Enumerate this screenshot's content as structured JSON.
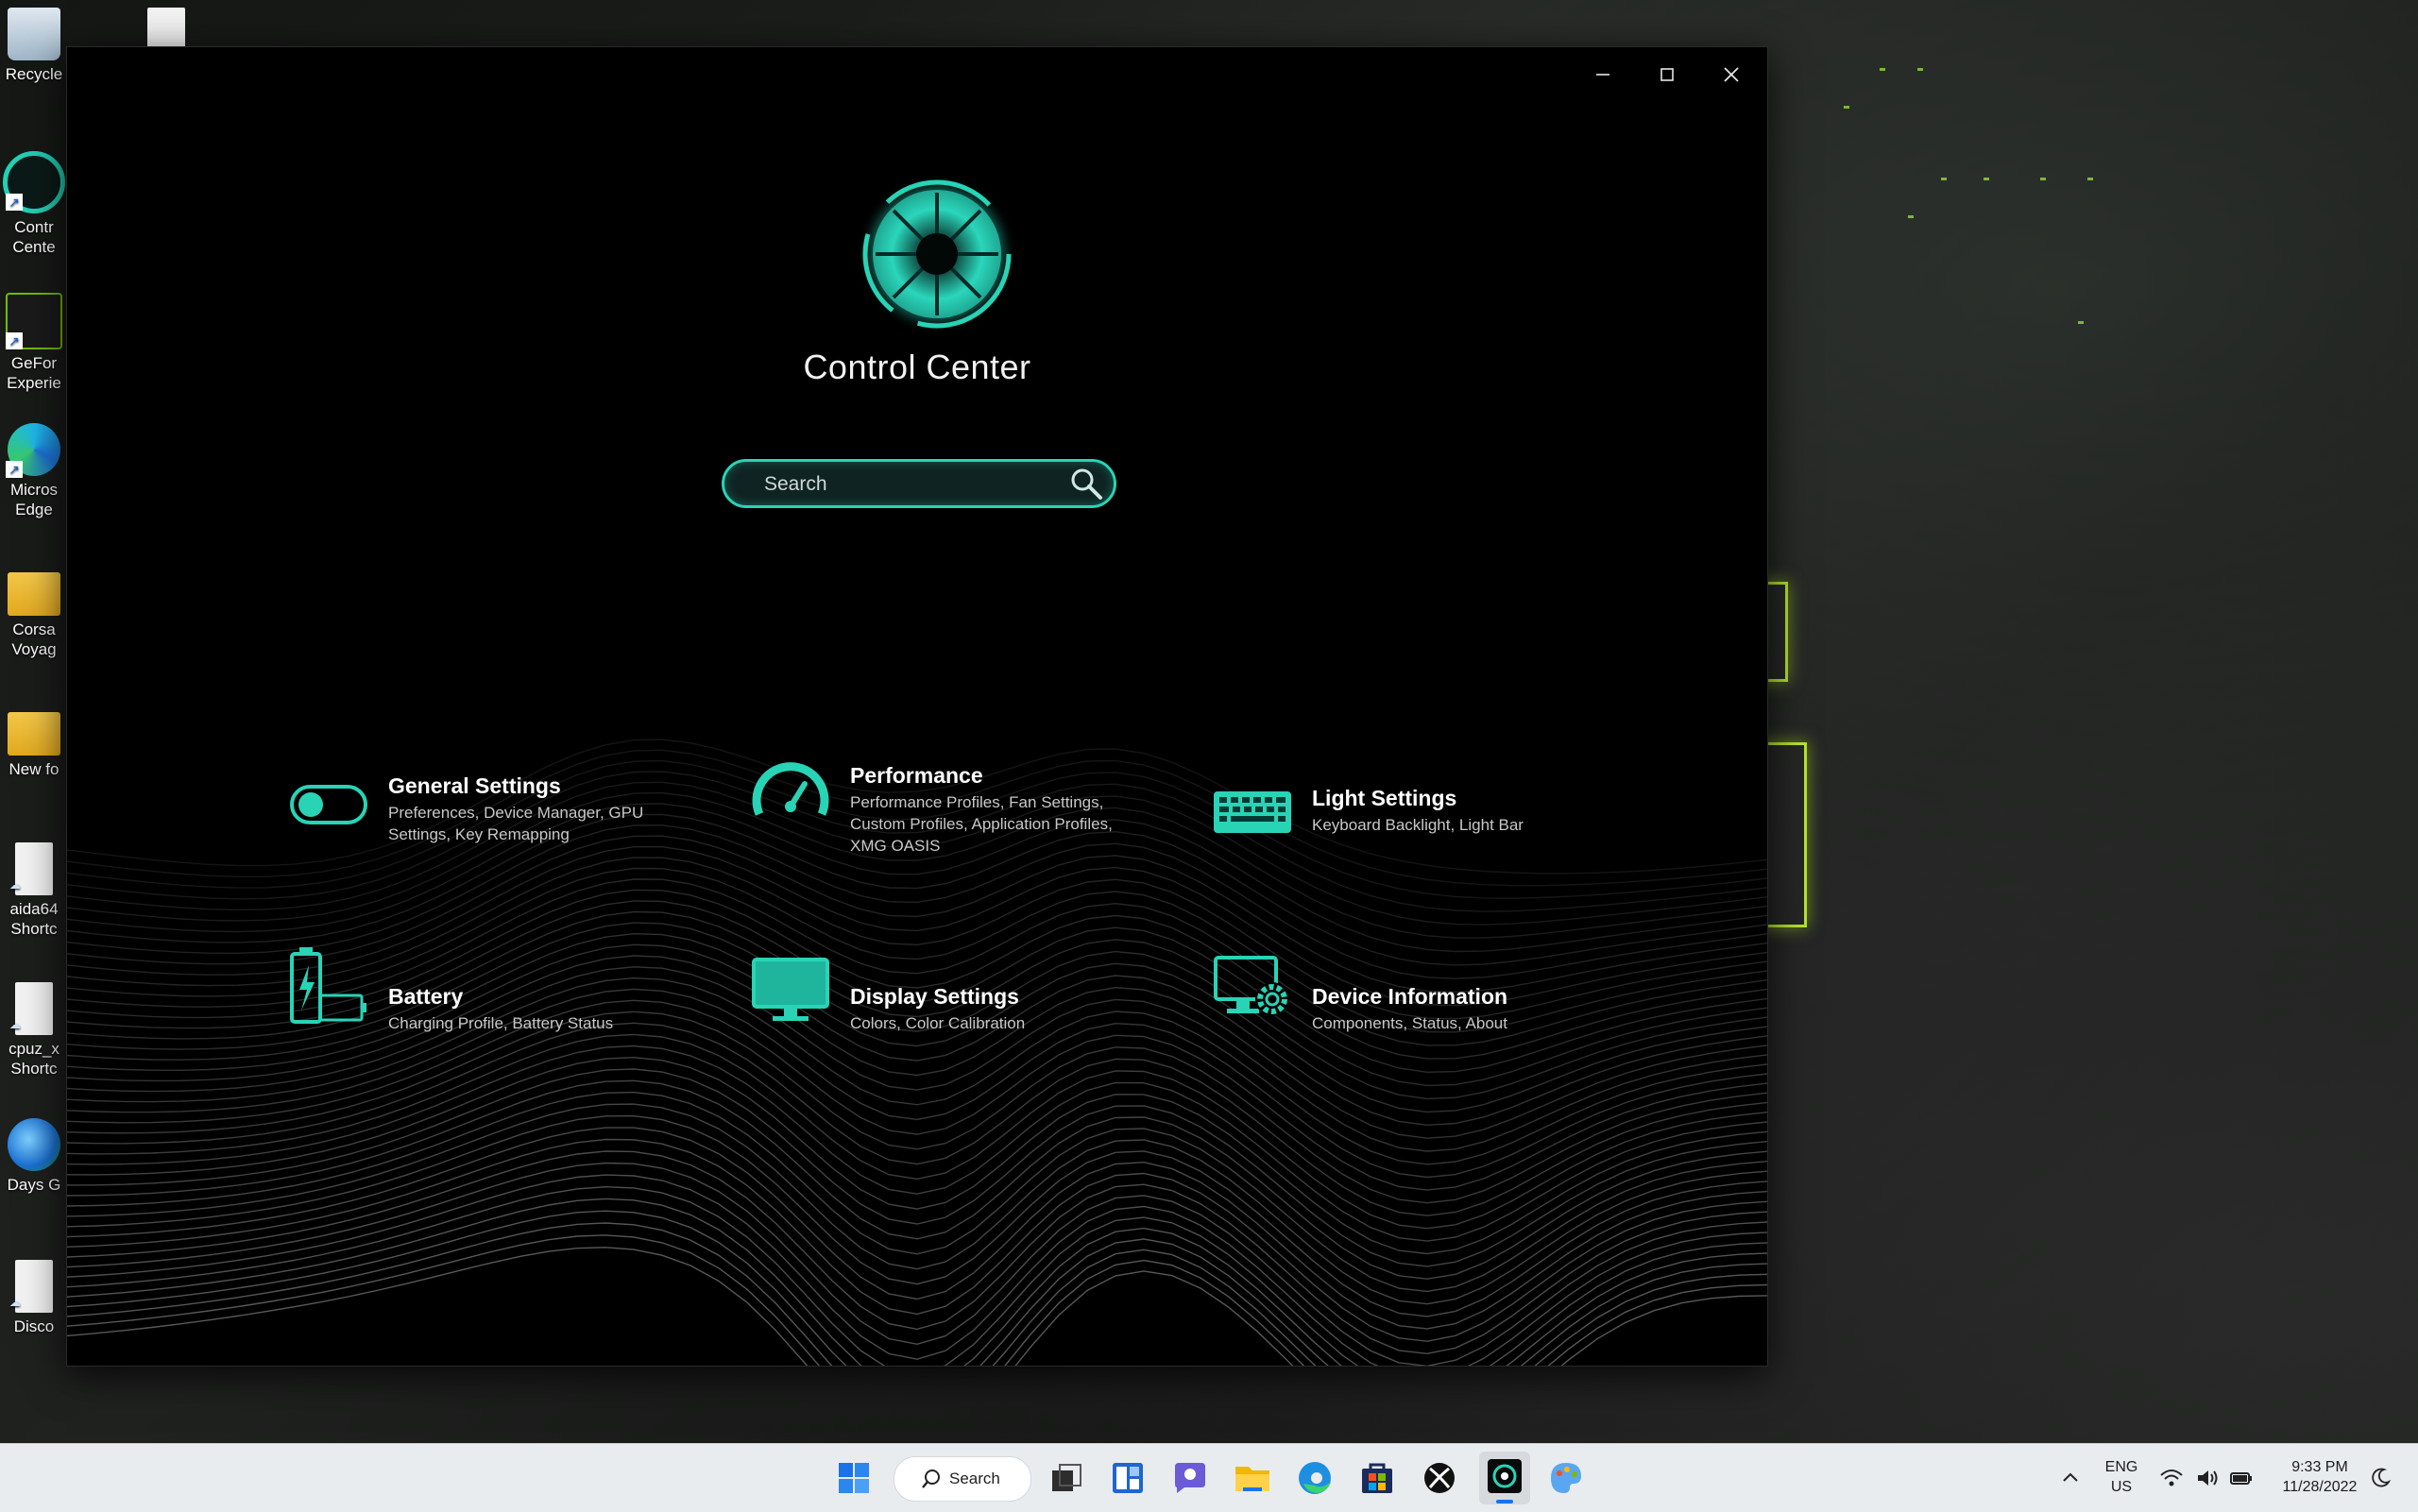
{
  "desktop": {
    "icons": [
      {
        "label": "Recycle",
        "type": "recycle"
      },
      {
        "label": "Contr\nCente",
        "type": "cc"
      },
      {
        "label": "GeFor\nExperie",
        "type": "nvidia"
      },
      {
        "label": "Micros\nEdge",
        "type": "edge"
      },
      {
        "label": "Corsa\nVoyag",
        "type": "folder"
      },
      {
        "label": "New fo",
        "type": "folder"
      },
      {
        "label": "aida64\nShortc",
        "type": "file"
      },
      {
        "label": "cpuz_x\nShortc",
        "type": "file"
      },
      {
        "label": "Days G",
        "type": "globe"
      },
      {
        "label": "Disco",
        "type": "file"
      }
    ]
  },
  "app": {
    "title": "Control Center",
    "search": {
      "placeholder": "Search"
    },
    "accent": "#29d3b6",
    "tiles": [
      {
        "id": "general",
        "title": "General Settings",
        "desc": "Preferences, Device Manager, GPU Settings, Key Remapping",
        "icon": "toggle-icon"
      },
      {
        "id": "performance",
        "title": "Performance",
        "desc": "Performance Profiles, Fan Settings, Custom Profiles, Application Profiles, XMG OASIS",
        "icon": "speedometer-icon"
      },
      {
        "id": "light",
        "title": "Light Settings",
        "desc": "Keyboard Backlight, Light Bar",
        "icon": "keyboard-icon"
      },
      {
        "id": "battery",
        "title": "Battery",
        "desc": "Charging Profile, Battery Status",
        "icon": "battery-icon"
      },
      {
        "id": "display",
        "title": "Display Settings",
        "desc": "Colors, Color Calibration",
        "icon": "monitor-icon"
      },
      {
        "id": "device",
        "title": "Device Information",
        "desc": "Components, Status, About",
        "icon": "monitor-gear-icon"
      }
    ]
  },
  "taskbar": {
    "search_label": "Search",
    "apps": [
      "start",
      "search",
      "task-view",
      "widgets",
      "chat",
      "file-explorer",
      "edge",
      "store",
      "xbox",
      "control-center",
      "paint"
    ],
    "tray": {
      "language_line1": "ENG",
      "language_line2": "US",
      "time": "9:33 PM",
      "date": "11/28/2022"
    }
  }
}
